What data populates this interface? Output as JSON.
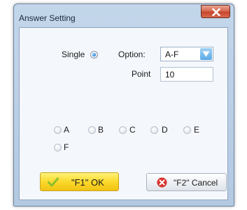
{
  "window": {
    "title": "Answer Setting"
  },
  "mode": {
    "single_label": "Single",
    "single_checked": true
  },
  "option": {
    "label": "Option:",
    "value": "A-F"
  },
  "point": {
    "label": "Point",
    "value": "10"
  },
  "choices": [
    {
      "label": "A"
    },
    {
      "label": "B"
    },
    {
      "label": "C"
    },
    {
      "label": "D"
    },
    {
      "label": "E"
    },
    {
      "label": "F"
    }
  ],
  "buttons": {
    "ok_label": "\"F1\" OK",
    "cancel_label": "\"F2\" Cancel"
  },
  "icons": {
    "close": "close-icon",
    "dropdown": "chevron-down-icon",
    "ok": "checkmark-icon",
    "cancel": "error-x-icon"
  },
  "colors": {
    "ok_button": "#fbd92c",
    "close_button": "#c7452b",
    "radio_selected": "#2c7dd6"
  }
}
